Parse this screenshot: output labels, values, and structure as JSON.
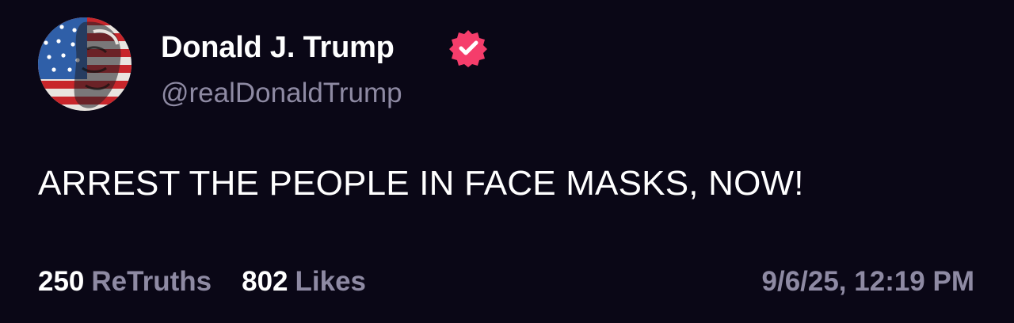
{
  "author": {
    "display_name": "Donald J. Trump",
    "handle": "@realDonaldTrump",
    "verified": true,
    "verified_icon": "verified-badge-icon",
    "verified_color": "#f53d6b"
  },
  "post": {
    "text": "ARREST THE PEOPLE IN FACE MASKS, NOW!"
  },
  "stats": {
    "retruths_count": "250",
    "retruths_label": "ReTruths",
    "likes_count": "802",
    "likes_label": "Likes"
  },
  "timestamp": "9/6/25, 12:19 PM",
  "colors": {
    "background": "#0a0716",
    "primary_text": "#ffffff",
    "secondary_text": "#8e8aa3"
  }
}
